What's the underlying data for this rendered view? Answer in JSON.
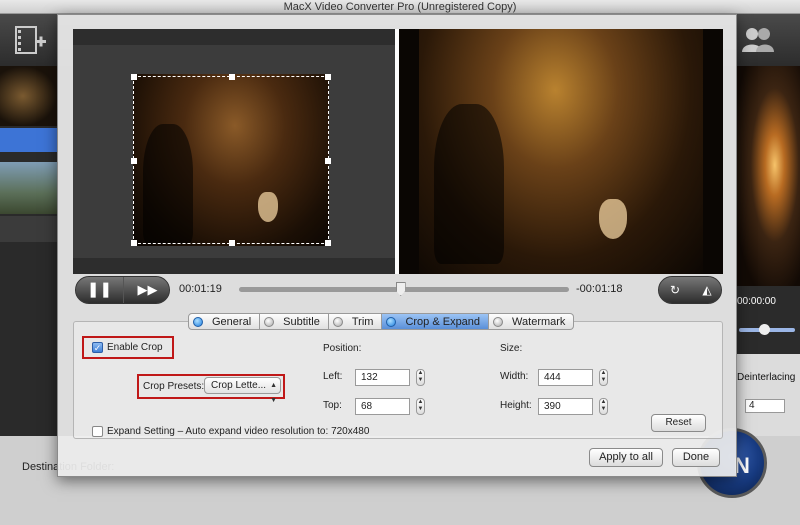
{
  "window": {
    "title": "MacX Video Converter Pro (Unregistered Copy)"
  },
  "background": {
    "time_display": "00:00:00",
    "deinterlacing_label": "Deinterlacing",
    "cpu_core_value": "4",
    "destination_label": "Destination Folder:",
    "run_label": "N"
  },
  "player": {
    "current_time": "00:01:19",
    "remaining_time": "-00:01:18",
    "position_fraction": 0.49
  },
  "tabs": [
    {
      "label": "General"
    },
    {
      "label": "Subtitle"
    },
    {
      "label": "Trim"
    },
    {
      "label": "Crop & Expand"
    },
    {
      "label": "Watermark"
    }
  ],
  "crop": {
    "enable_label": "Enable Crop",
    "enabled": true,
    "presets_label": "Crop Presets:",
    "preset_value": "Crop Lette...",
    "position_label": "Position:",
    "left_label": "Left:",
    "left_value": "132",
    "top_label": "Top:",
    "top_value": "68",
    "size_label": "Size:",
    "width_label": "Width:",
    "width_value": "444",
    "height_label": "Height:",
    "height_value": "390",
    "reset_label": "Reset",
    "expand_label": "Expand Setting – Auto expand video resolution to:",
    "expand_value": "720x480"
  },
  "buttons": {
    "apply_all": "Apply to all",
    "done": "Done"
  }
}
